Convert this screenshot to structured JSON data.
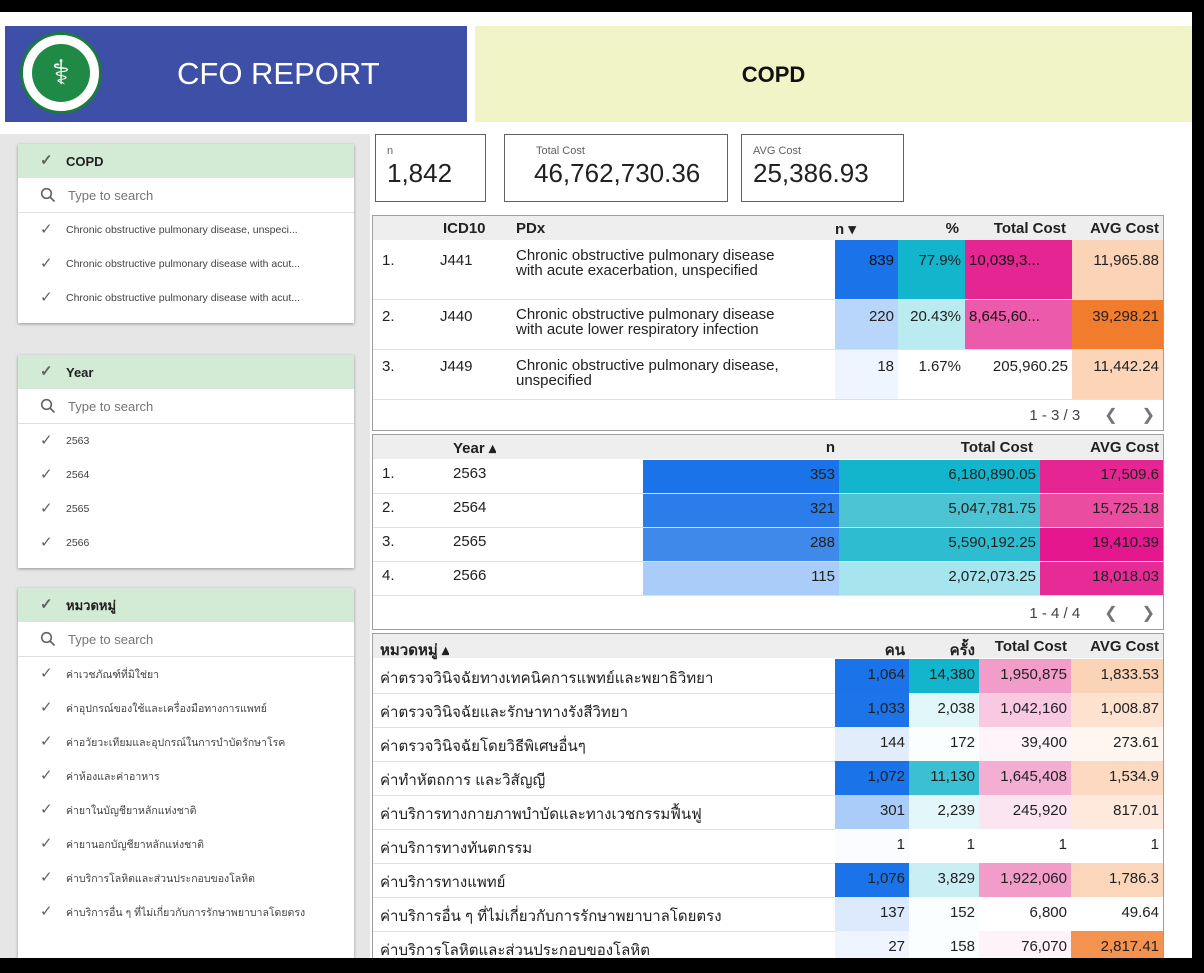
{
  "header": {
    "app_title": "CFO REPORT",
    "topic": "COPD",
    "logo_text": "กระทรวงสาธารณสุข MINISTRY OF PUBLIC HEALTH"
  },
  "filters": [
    {
      "title": "COPD",
      "search_placeholder": "Type to search",
      "items": [
        "Chronic obstructive pulmonary disease, unspeci...",
        "Chronic obstructive pulmonary disease with acut...",
        "Chronic obstructive pulmonary disease with acut..."
      ]
    },
    {
      "title": "Year",
      "search_placeholder": "Type to search",
      "items": [
        "2563",
        "2564",
        "2565",
        "2566"
      ]
    },
    {
      "title": "หมวดหมู่",
      "search_placeholder": "Type to search",
      "items": [
        "ค่าเวชภัณฑ์ที่มิใช่ยา",
        "ค่าอุปกรณ์ของใช้และเครื่องมือทางการแพทย์",
        "ค่าอวัยวะเทียมและอุปกรณ์ในการบำบัดรักษาโรค",
        "ค่าห้องและค่าอาหาร",
        "ค่ายาในบัญชียาหลักแห่งชาติ",
        "ค่ายานอกบัญชียาหลักแห่งชาติ",
        "ค่าบริการโลหิตและส่วนประกอบของโลหิต",
        "ค่าบริการอื่น ๆ ที่ไม่เกี่ยวกับการรักษาพยาบาลโดยตรง"
      ]
    }
  ],
  "scorecards": [
    {
      "label": "n",
      "value": "1,842"
    },
    {
      "label": "Total Cost",
      "value": "46,762,730.36"
    },
    {
      "label": "AVG Cost",
      "value": "25,386.93"
    }
  ],
  "table_icd": {
    "headers": {
      "icd": "ICD10",
      "pdx": "PDx",
      "n": "n ▾",
      "pct": "%",
      "total": "Total Cost",
      "avg": "AVG Cost"
    },
    "rows": [
      {
        "idx": "1.",
        "icd": "J441",
        "pdx1": "Chronic obstructive pulmonary disease",
        "pdx2": "with acute exacerbation, unspecified",
        "n": "839",
        "pct": "77.9%",
        "total": "10,039,3...",
        "avg": "11,965.88"
      },
      {
        "idx": "2.",
        "icd": "J440",
        "pdx1": "Chronic obstructive pulmonary disease",
        "pdx2": "with acute lower respiratory infection",
        "n": "220",
        "pct": "20.43%",
        "total": "8,645,60...",
        "avg": "39,298.21"
      },
      {
        "idx": "3.",
        "icd": "J449",
        "pdx1": "Chronic obstructive pulmonary disease,",
        "pdx2": "unspecified",
        "n": "18",
        "pct": "1.67%",
        "total": "205,960.25",
        "avg": "11,442.24"
      }
    ],
    "pager": "1 - 3 / 3"
  },
  "table_year": {
    "headers": {
      "year": "Year ▴",
      "n": "n",
      "total": "Total Cost",
      "avg": "AVG Cost"
    },
    "rows": [
      {
        "idx": "1.",
        "year": "2563",
        "n": "353",
        "total": "6,180,890.05",
        "avg": "17,509.6"
      },
      {
        "idx": "2.",
        "year": "2564",
        "n": "321",
        "total": "5,047,781.75",
        "avg": "15,725.18"
      },
      {
        "idx": "3.",
        "year": "2565",
        "n": "288",
        "total": "5,590,192.25",
        "avg": "19,410.39"
      },
      {
        "idx": "4.",
        "year": "2566",
        "n": "115",
        "total": "2,072,073.25",
        "avg": "18,018.03"
      }
    ],
    "pager": "1 - 4 / 4"
  },
  "table_category": {
    "headers": {
      "cat": "หมวดหมู่ ▴",
      "people": "คน",
      "times": "ครั้ง",
      "total": "Total Cost",
      "avg": "AVG Cost"
    },
    "rows": [
      {
        "cat": "ค่าตรวจวินิจฉัยทางเทคนิคการแพทย์และพยาธิวิทยา",
        "people": "1,064",
        "times": "14,380",
        "total": "1,950,875",
        "avg": "1,833.53"
      },
      {
        "cat": "ค่าตรวจวินิจฉัยและรักษาทางรังสีวิทยา",
        "people": "1,033",
        "times": "2,038",
        "total": "1,042,160",
        "avg": "1,008.87"
      },
      {
        "cat": "ค่าตรวจวินิจฉัยโดยวิธีพิเศษอื่นๆ",
        "people": "144",
        "times": "172",
        "total": "39,400",
        "avg": "273.61"
      },
      {
        "cat": "ค่าทำหัตถการ และวิสัญญี",
        "people": "1,072",
        "times": "11,130",
        "total": "1,645,408",
        "avg": "1,534.9"
      },
      {
        "cat": "ค่าบริการทางกายภาพบำบัดและทางเวชกรรมฟื้นฟู",
        "people": "301",
        "times": "2,239",
        "total": "245,920",
        "avg": "817.01"
      },
      {
        "cat": "ค่าบริการทางทันตกรรม",
        "people": "1",
        "times": "1",
        "total": "1",
        "avg": "1"
      },
      {
        "cat": "ค่าบริการทางแพทย์",
        "people": "1,076",
        "times": "3,829",
        "total": "1,922,060",
        "avg": "1,786.3"
      },
      {
        "cat": "ค่าบริการอื่น ๆ ที่ไม่เกี่ยวกับการรักษาพยาบาลโดยตรง",
        "people": "137",
        "times": "152",
        "total": "6,800",
        "avg": "49.64"
      },
      {
        "cat": "ค่าบริการโลหิตและส่วนประกอบของโลหิต",
        "people": "27",
        "times": "158",
        "total": "76,070",
        "avg": "2,817.41"
      }
    ]
  },
  "colors": {
    "header_blue": "#3d4fa6",
    "topic_bg": "#f0f4c6",
    "filter_head_bg": "#d3ead5",
    "n_heat_dark": "#1a73e8",
    "teal": "#12b5cb",
    "pink": "#e52592",
    "orange": "#f17c2e"
  }
}
